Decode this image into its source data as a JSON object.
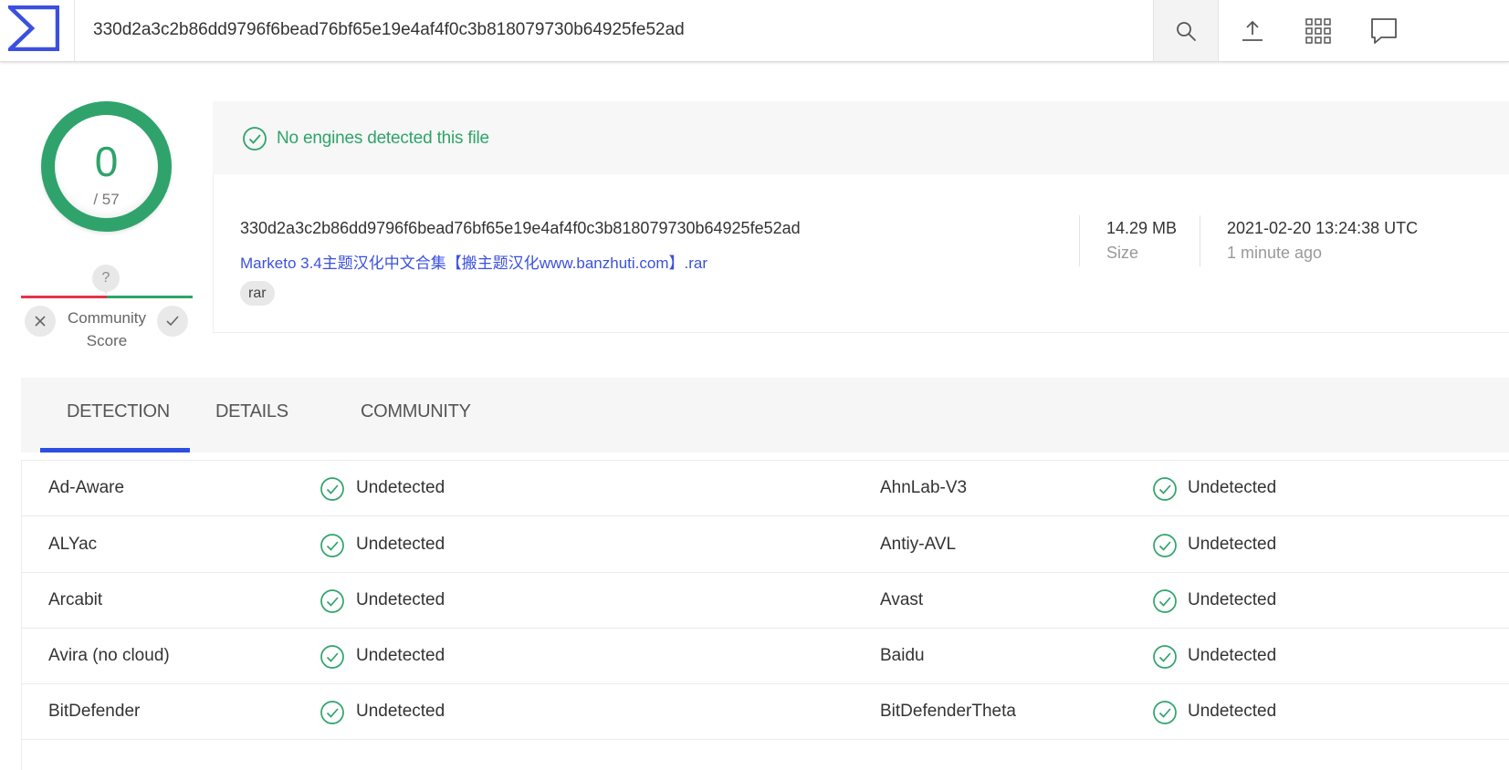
{
  "header": {
    "search_value": "330d2a3c2b86dd9796f6bead76bf65e19e4af4f0c3b818079730b64925fe52ad",
    "icons": [
      "sigma-logo-icon",
      "search-icon",
      "upload-icon",
      "apps-grid-icon",
      "chat-icon"
    ]
  },
  "score": {
    "detected": "0",
    "total": "/ 57",
    "ring_color": "#2fa36b",
    "community_value": "?",
    "community_label_line1": "Community",
    "community_label_line2": "Score"
  },
  "banner": {
    "text": "No engines detected this file",
    "color": "#2fa36b"
  },
  "file": {
    "hash": "330d2a3c2b86dd9796f6bead76bf65e19e4af4f0c3b818079730b64925fe52ad",
    "name": "Marketo 3.4主题汉化中文合集【搬主题汉化www.banzhuti.com】.rar",
    "tag": "rar",
    "size_value": "14.29 MB",
    "size_label": "Size",
    "date_value": "2021-02-20 13:24:38 UTC",
    "date_relative": "1 minute ago"
  },
  "tabs": [
    {
      "label": "DETECTION",
      "active": true
    },
    {
      "label": "DETAILS",
      "active": false
    },
    {
      "label": "COMMUNITY",
      "active": false
    }
  ],
  "accent_color": "#2b4fe0",
  "results": [
    {
      "left_engine": "Ad-Aware",
      "left_status": "Undetected",
      "right_engine": "AhnLab-V3",
      "right_status": "Undetected"
    },
    {
      "left_engine": "ALYac",
      "left_status": "Undetected",
      "right_engine": "Antiy-AVL",
      "right_status": "Undetected"
    },
    {
      "left_engine": "Arcabit",
      "left_status": "Undetected",
      "right_engine": "Avast",
      "right_status": "Undetected"
    },
    {
      "left_engine": "Avira (no cloud)",
      "left_status": "Undetected",
      "right_engine": "Baidu",
      "right_status": "Undetected"
    },
    {
      "left_engine": "BitDefender",
      "left_status": "Undetected",
      "right_engine": "BitDefenderTheta",
      "right_status": "Undetected"
    }
  ]
}
